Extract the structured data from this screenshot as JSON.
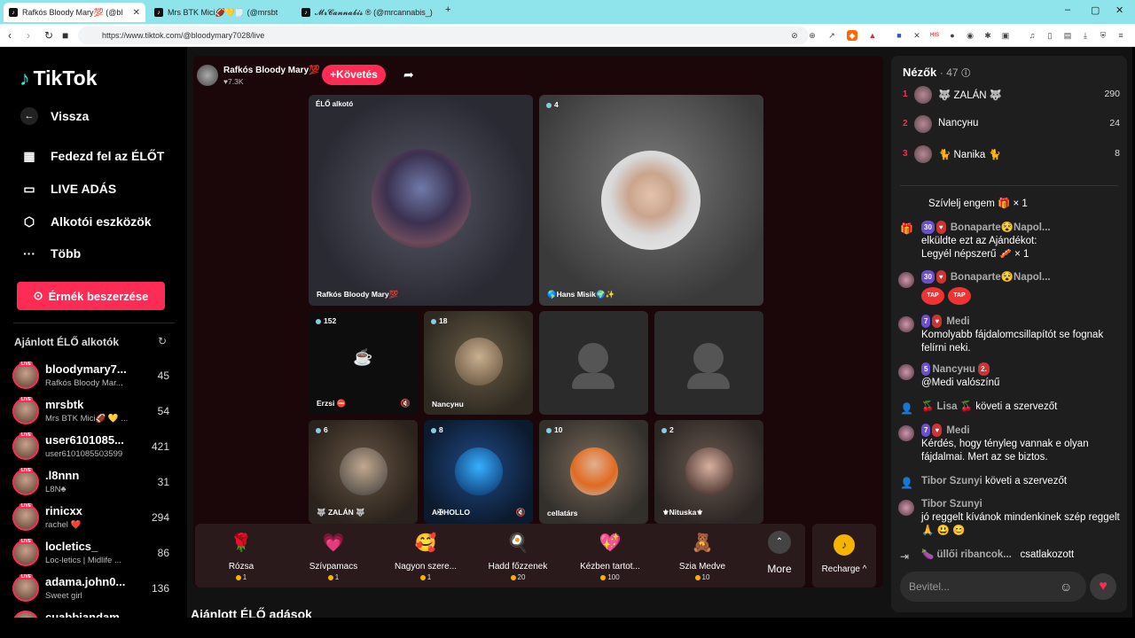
{
  "browser": {
    "tabs": [
      {
        "label": "Rafkós Bloody Mary💯 (@bl",
        "active": true
      },
      {
        "label": "Mrs BTK Mici🏈💛🗒️ (@mrsbt",
        "active": false
      },
      {
        "label": "𝓜𝓻𝓒𝓪𝓷𝓷𝓪𝓫𝓲𝓼 ® (@mrcannabis_)",
        "active": false
      }
    ],
    "url": "https://www.tiktok.com/@bloodymary7028/live"
  },
  "sidebar": {
    "logo": "TikTok",
    "back": "Vissza",
    "nav": [
      "Fedezd fel az ÉLŐT",
      "LIVE ADÁS",
      "Alkotói eszközök",
      "Több"
    ],
    "coins_button": "Érmék beszerzése",
    "recommended_title": "Ajánlott ÉLŐ alkotók",
    "live_badge": "LIVE",
    "creators": [
      {
        "name": "bloodymary7...",
        "sub": "Rafkós Bloody Mar...",
        "count": "45"
      },
      {
        "name": "mrsbtk",
        "sub": "Mrs BTK Mici🏈 💛 ...",
        "count": "54"
      },
      {
        "name": "user6101085...",
        "sub": "user6101085503599",
        "count": "421"
      },
      {
        "name": ".l8nnn",
        "sub": "L8N♣",
        "count": "31"
      },
      {
        "name": "rinicxx",
        "sub": "rachel ❤️",
        "count": "294"
      },
      {
        "name": "locletics_",
        "sub": "Loc-letics | Midlife ...",
        "count": "86"
      },
      {
        "name": "adama.john0...",
        "sub": "Sweet girl",
        "count": "136"
      },
      {
        "name": "cuabbiandam",
        "sub": "",
        "count": ""
      }
    ]
  },
  "stream": {
    "host_name": "Rafkós Bloody Mary💯",
    "host_likes": "♥7.3K",
    "follow": "+Követés",
    "host_cell_label": "ÉLŐ alkotó",
    "host_cell_name": "Rafkós Bloody Mary💯",
    "guests": [
      {
        "count": "4",
        "name": "🌎Hans Misik🌍✨"
      },
      {
        "count": "152",
        "name": "Erzsi ⛔"
      },
      {
        "count": "18",
        "name": "Nancyнu"
      },
      {
        "count": "6",
        "name": "🐺 ZALÁN 🐺"
      },
      {
        "count": "8",
        "name": "A✠HOLLO"
      },
      {
        "count": "10",
        "name": "cellatárs"
      },
      {
        "count": "2",
        "name": "⚜Nituska⚜"
      }
    ]
  },
  "gifts": [
    {
      "name": "Rózsa",
      "price": "1",
      "icon": "🌹"
    },
    {
      "name": "Szívpamacs",
      "price": "1",
      "icon": "💗"
    },
    {
      "name": "Nagyon szere...",
      "price": "1",
      "icon": "🥰"
    },
    {
      "name": "Hadd főzzenek",
      "price": "20",
      "icon": "🍳"
    },
    {
      "name": "Kézben tartot...",
      "price": "100",
      "icon": "💖"
    },
    {
      "name": "Szia Medve",
      "price": "10",
      "icon": "🧸"
    }
  ],
  "more_label": "More",
  "recharge_label": "Recharge ^",
  "recommended_live": "Ajánlott ÉLŐ adások",
  "viewers": {
    "title": "Nézők",
    "count": "· 47",
    "list": [
      {
        "rank": "1",
        "name": "🐺 ZALÁN 🐺",
        "score": "290"
      },
      {
        "rank": "2",
        "name": "Nancyнu",
        "score": "24"
      },
      {
        "rank": "3",
        "name": "🐈 Nanika 🐈",
        "score": "8"
      }
    ]
  },
  "chat": {
    "m0": {
      "text": "Szívlelj engem 🎁 × 1"
    },
    "m1": {
      "badge": "30",
      "user": "Bonaparte😵Napol...",
      "line1": "elküldte ezt az Ajándékot:",
      "line2": "Legyél népszerű 🥓 × 1"
    },
    "m2": {
      "badge": "30",
      "user": "Bonaparte😵Napol...",
      "tap": "TAP"
    },
    "m3": {
      "badge": "7",
      "user": "Medi",
      "text": "Komolyabb fájdalomcsillapítót se fognak felírni neki."
    },
    "m4": {
      "badge": "5",
      "user": "Nancyнu",
      "badge2": "2.",
      "text": "@Medi valószínű"
    },
    "m5": {
      "user": "🍒 Lisa 🍒",
      "action": "követi a szervezőt"
    },
    "m6": {
      "badge": "7",
      "user": "Medi",
      "text": "Kérdés, hogy tényleg vannak e olyan fájdalmai. Mert az se biztos."
    },
    "m7": {
      "user": "Tibor Szunyi",
      "action": "követi a szervezőt"
    },
    "m8": {
      "user": "Tibor Szunyi",
      "text": "jó reggelt kívánok mindenkinek szép reggelt 🙏 😃 😊"
    },
    "m9": {
      "user": "🍆 üllői ribancok...",
      "action": "csatlakozott"
    }
  },
  "input_placeholder": "Bevitel..."
}
